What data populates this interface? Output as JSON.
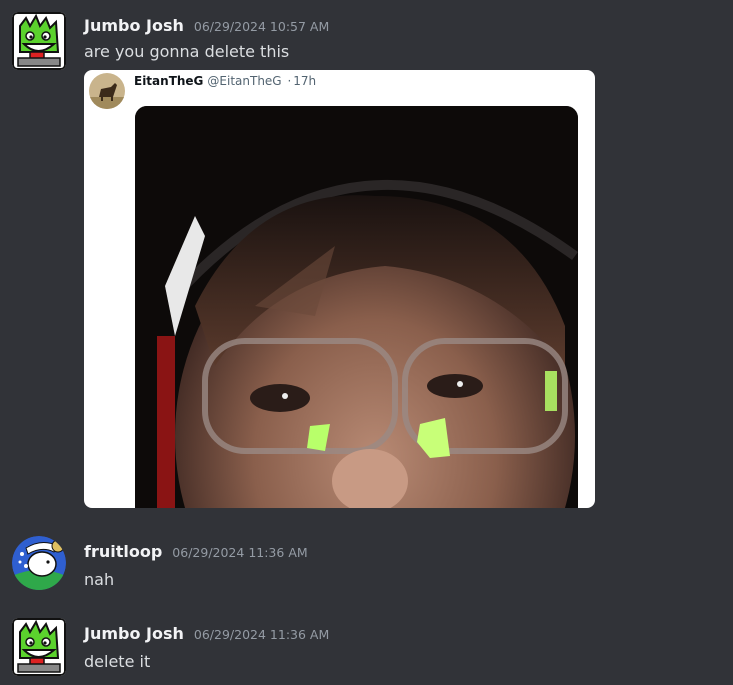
{
  "messages": [
    {
      "username": "Jumbo Josh",
      "timestamp": "06/29/2024 10:57 AM",
      "text": "are you gonna delete this",
      "avatar_icon": "green-creature-avatar-icon",
      "embed": {
        "author_name": "EitanTheG",
        "handle": "@EitanTheG",
        "separator": "·",
        "time": "17h",
        "media_icon": "selfie-video-frame"
      }
    },
    {
      "username": "fruitloop",
      "timestamp": "06/29/2024 11:36 AM",
      "text": "nah",
      "avatar_icon": "blue-character-avatar-icon"
    },
    {
      "username": "Jumbo Josh",
      "timestamp": "06/29/2024 11:36 AM",
      "text": "delete it",
      "avatar_icon": "green-creature-avatar-icon"
    }
  ],
  "colors": {
    "background": "#313338",
    "username": "#f2f3f5",
    "timestamp": "#949ba4",
    "message_text": "#dbdee1",
    "embed_bg": "#ffffff"
  }
}
